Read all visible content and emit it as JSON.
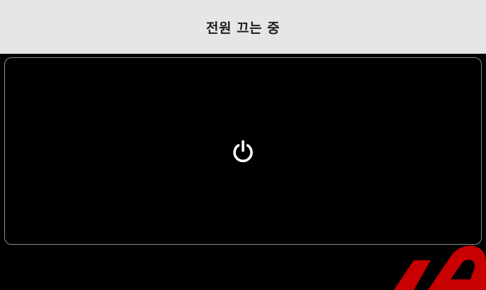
{
  "header": {
    "title": "전원 끄는 중"
  },
  "panel": {
    "icon": "power-icon"
  },
  "colors": {
    "header_bg": "#e6e6e6",
    "screen_bg": "#000000",
    "panel_border": "#8a8a8a",
    "icon_color": "#ffffff",
    "watermark_color": "#c80000"
  }
}
